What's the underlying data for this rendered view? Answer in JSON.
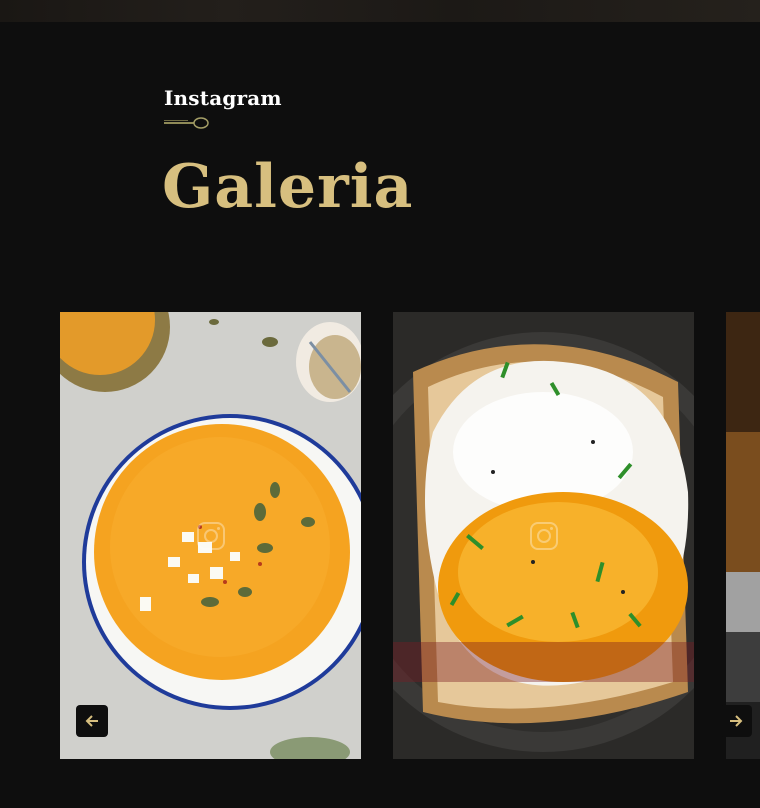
{
  "gallery": {
    "label": "Instagram",
    "title": "Galeria",
    "items": [
      {
        "name": "pumpkin-soup-photo",
        "icon": "instagram-icon"
      },
      {
        "name": "fried-egg-toast-photo",
        "icon": "instagram-icon"
      },
      {
        "name": "seafood-photo",
        "icon": "instagram-icon"
      }
    ],
    "controls": {
      "prev_icon": "arrow-left-icon",
      "next_icon": "arrow-right-icon"
    }
  },
  "colors": {
    "background": "#0e0e0e",
    "accent_gold": "#d7bf7f",
    "label_white": "#ffffff"
  }
}
